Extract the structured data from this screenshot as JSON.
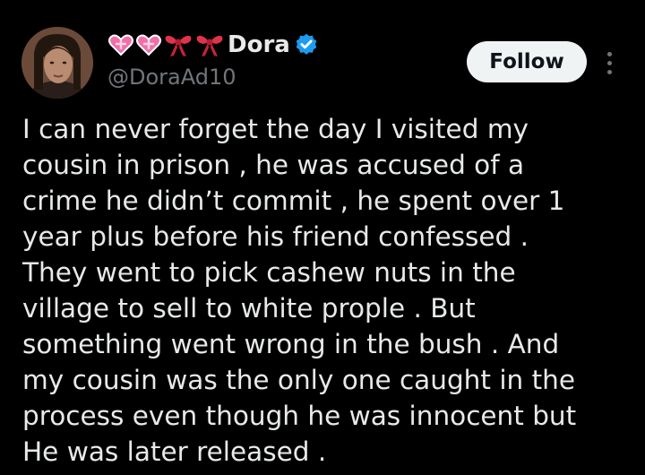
{
  "user": {
    "display_name": "Dora",
    "handle": "@DoraAd10",
    "name_emojis": [
      "heart-ribbon",
      "heart-ribbon",
      "ribbon",
      "ribbon"
    ],
    "verified": true
  },
  "actions": {
    "follow_label": "Follow"
  },
  "tweet": {
    "text": "I can never forget the day I visited my\ncousin in prison , he was accused of a\ncrime he didn’t commit , he spent over 1\nyear plus before his friend confessed .\nThey went to pick cashew nuts in the\nvillage to sell to white prople . But\nsomething went wrong in the bush . And\nmy cousin was the only one caught in the\nprocess even though he was innocent but\nHe was later released ."
  },
  "colors": {
    "background": "#000000",
    "text_primary": "#e7e9ea",
    "text_secondary": "#71767b",
    "verified_blue": "#1d9bf0",
    "follow_bg": "#eff3f4",
    "heart_pink": "#f06fa8",
    "ribbon_red": "#e0334b"
  }
}
